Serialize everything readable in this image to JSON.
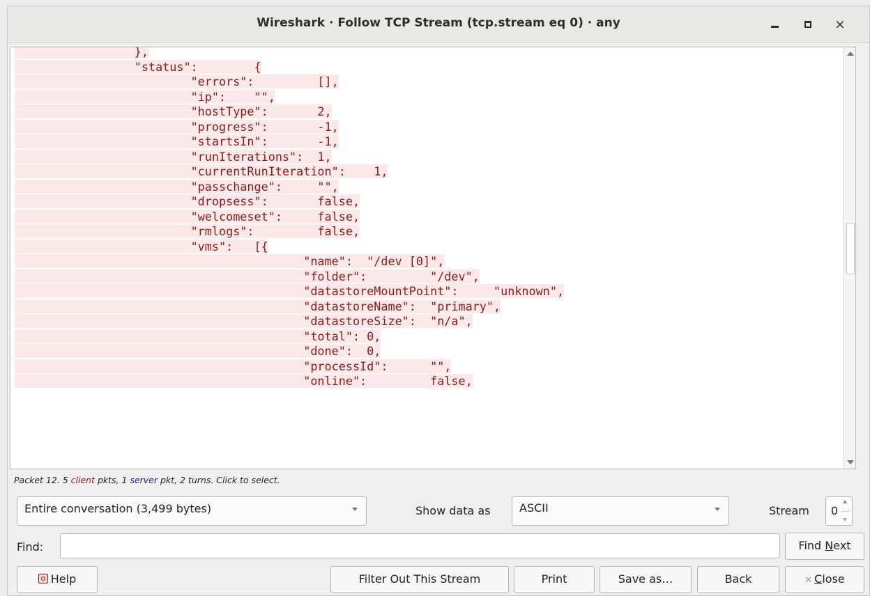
{
  "window": {
    "title": "Wireshark · Follow TCP Stream (tcp.stream eq 0) · any"
  },
  "stream": {
    "lines": [
      "                 },",
      "                 \"status\":        {",
      "                         \"errors\":         [],",
      "                         \"ip\":    \"\",",
      "                         \"hostType\":       2,",
      "                         \"progress\":       -1,",
      "                         \"startsIn\":       -1,",
      "                         \"runIterations\":  1,",
      "                         \"currentRunIteration\":    1,",
      "                         \"passchange\":     \"\",",
      "                         \"dropsess\":       false,",
      "                         \"welcomeset\":     false,",
      "                         \"rmlogs\":         false,",
      "                         \"vms\":   [{",
      "                                         \"name\":  \"/dev [0]\",",
      "                                         \"folder\":         \"/dev\",",
      "                                         \"datastoreMountPoint\":     \"unknown\",",
      "                                         \"datastoreName\":  \"primary\",",
      "                                         \"datastoreSize\":  \"n/a\",",
      "                                         \"total\": 0,",
      "                                         \"done\":  0,",
      "                                         \"processId\":      \"\",",
      "                                         \"online\":         false,"
    ]
  },
  "info": {
    "prefix": "Packet 12. 5 ",
    "client": "client",
    "middle": " pkts, 1 ",
    "server": "server",
    "suffix": " pkt, 2 turns. Click to select."
  },
  "controls": {
    "conversation": "Entire conversation (3,499 bytes)",
    "show_data_as_label": "Show data as",
    "show_data_as_value": "ASCII",
    "stream_label": "Stream",
    "stream_value": "0",
    "find_label": "Find:",
    "find_value": "",
    "find_next": {
      "pre": "Find ",
      "key": "N",
      "post": "ext"
    }
  },
  "buttons": {
    "help": "Help",
    "filter_out": "Filter Out This Stream",
    "print": "Print",
    "save_as": "Save as…",
    "back": "Back",
    "close": {
      "key": "C",
      "post": "lose"
    }
  },
  "colors": {
    "client_text": "#8b1a1a",
    "client_bg": "#fbe9e9",
    "server_text": "#1a1a8b"
  }
}
